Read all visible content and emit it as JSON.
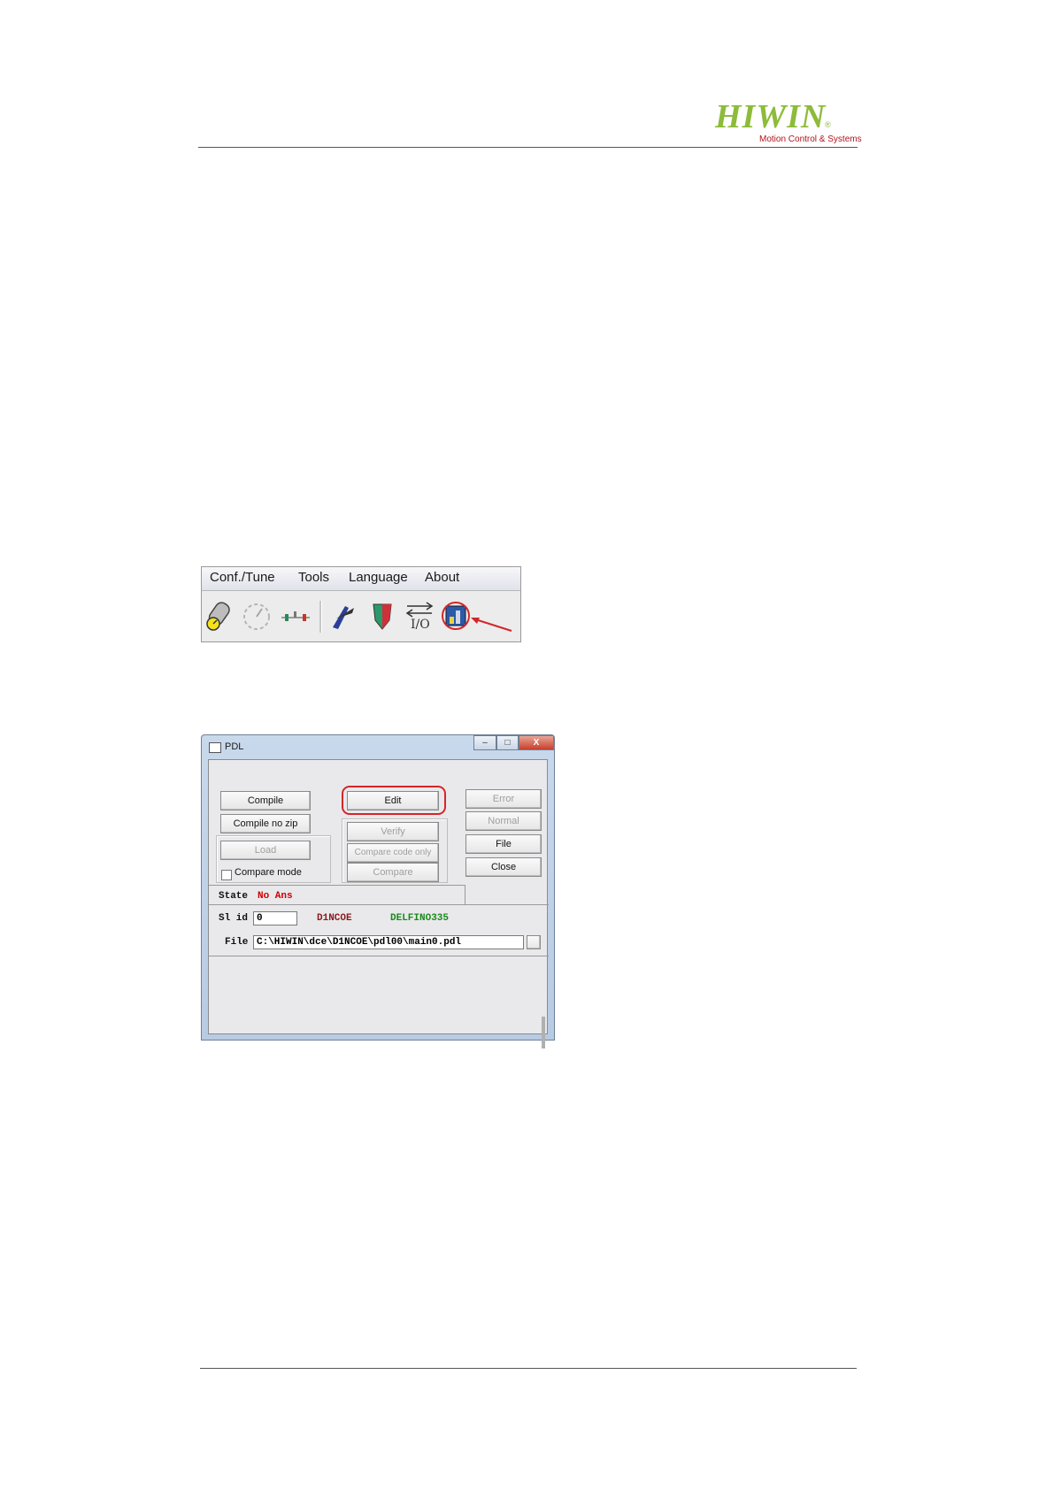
{
  "header": {
    "logo_text": "HIWIN",
    "logo_reg": "®",
    "logo_tagline": "Motion Control & Systems"
  },
  "menu_screenshot": {
    "menu_items": [
      "Conf./Tune",
      "Tools",
      "Language",
      "About"
    ],
    "toolbar_icons": [
      "motor-icon",
      "gauge-icon",
      "sliders-icon",
      "tuning-icon",
      "shield-icon",
      "io-icon",
      "pdl-icon"
    ],
    "io_label": "I/O",
    "highlight_color": "#d3262a"
  },
  "pdl_dialog": {
    "title": "PDL",
    "window_buttons": [
      "–",
      "□",
      "X"
    ],
    "buttons": {
      "compile": "Compile",
      "compile_no_zip": "Compile no zip",
      "load": "Load",
      "edit": "Edit",
      "verify": "Verify",
      "compare_code_only": "Compare code only",
      "compare": "Compare",
      "error": "Error",
      "normal": "Normal",
      "file": "File",
      "close": "Close"
    },
    "compare_mode_label": "Compare mode",
    "state_label": "State",
    "state_value": "No Ans",
    "slid_label": "Sl id",
    "slid_value": "0",
    "drive_name": "D1NCOE",
    "processor_name": "DELFINO335",
    "file_label": "File",
    "file_path": "C:\\HIWIN\\dce\\D1NCOE\\pdl00\\main0.pdl"
  }
}
